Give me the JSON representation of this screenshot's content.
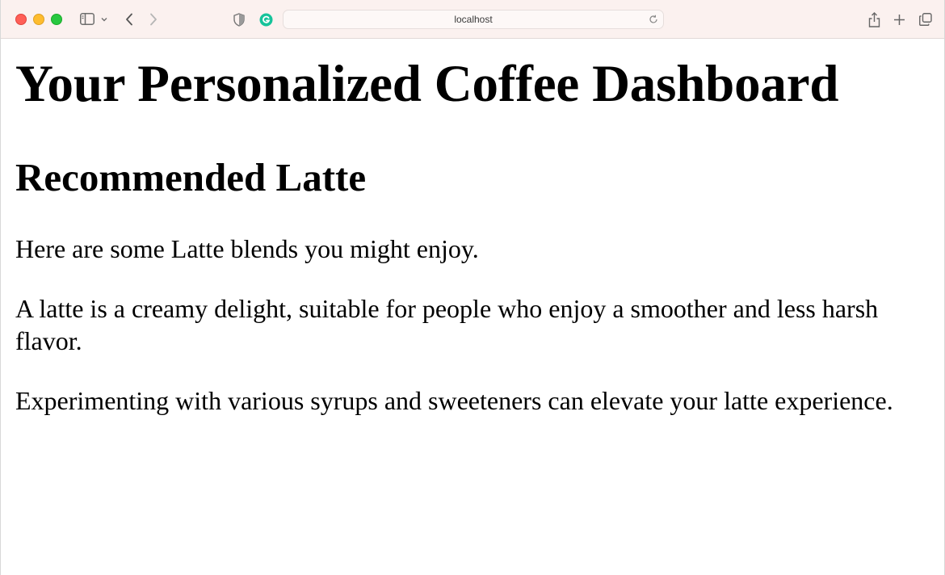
{
  "browser": {
    "url": "localhost",
    "colors": {
      "toolbar_bg": "#fbf1ef",
      "close": "#ff5f57",
      "minimize": "#febc2e",
      "maximize": "#28c840",
      "grammarly": "#15c39a"
    },
    "icons": [
      "sidebar-icon",
      "chevron-down-icon",
      "back-arrow-icon",
      "forward-arrow-icon",
      "shield-icon",
      "grammarly-icon",
      "reload-icon",
      "share-icon",
      "plus-icon",
      "tabs-icon"
    ]
  },
  "page": {
    "title": "Your Personalized Coffee Dashboard",
    "section_heading": "Recommended Latte",
    "paragraphs": [
      "Here are some Latte blends you might enjoy.",
      "A latte is a creamy delight, suitable for people who enjoy a smoother and less harsh flavor.",
      "Experimenting with various syrups and sweeteners can elevate your latte experience."
    ]
  }
}
